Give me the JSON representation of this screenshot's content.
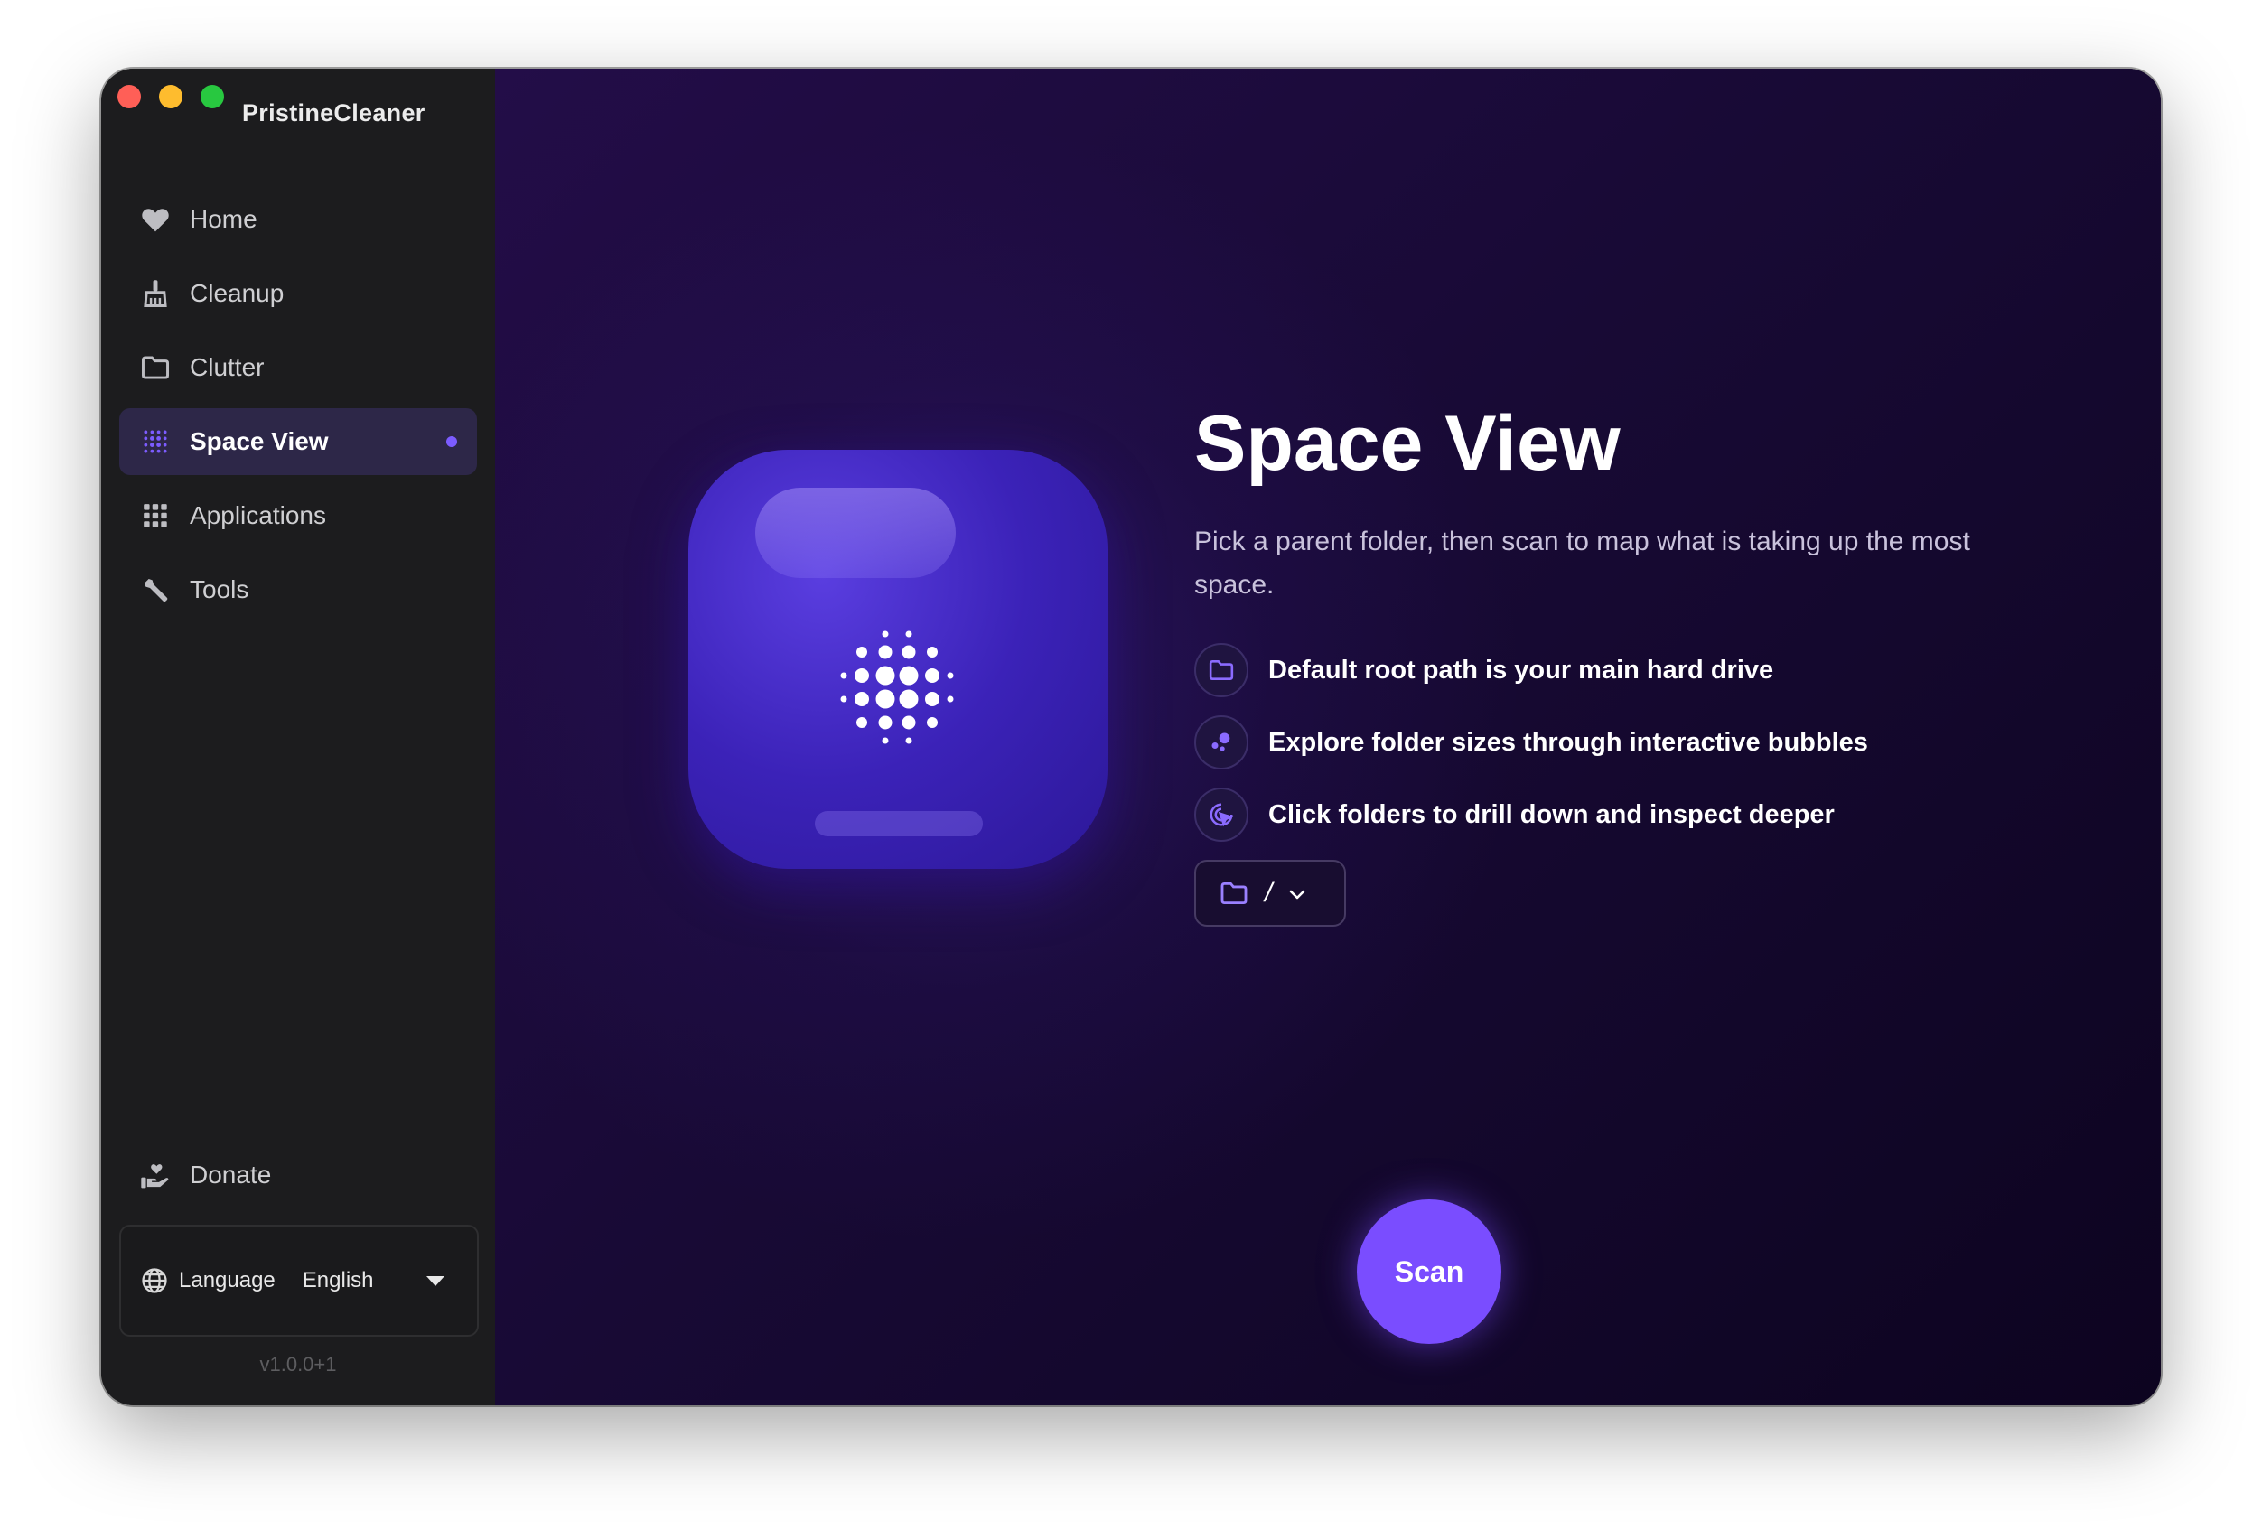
{
  "app": {
    "title": "PristineCleaner",
    "version": "v1.0.0+1"
  },
  "sidebar": {
    "items": [
      {
        "label": "Home",
        "icon": "heart-icon"
      },
      {
        "label": "Cleanup",
        "icon": "broom-icon"
      },
      {
        "label": "Clutter",
        "icon": "folder-icon"
      },
      {
        "label": "Space View",
        "icon": "dot-grid-icon",
        "active": true
      },
      {
        "label": "Applications",
        "icon": "apps-grid-icon"
      },
      {
        "label": "Tools",
        "icon": "wrench-icon"
      }
    ],
    "donate_label": "Donate",
    "language_label": "Language",
    "language_value": "English"
  },
  "main": {
    "title": "Space View",
    "subtitle": "Pick a parent folder, then scan to map what is taking up the most space.",
    "features": [
      {
        "text": "Default root path is your main hard drive",
        "icon": "folder-icon"
      },
      {
        "text": "Explore folder sizes through interactive bubbles",
        "icon": "bubbles-icon"
      },
      {
        "text": "Click folders to drill down and inspect deeper",
        "icon": "cursor-click-icon"
      }
    ],
    "path_value": "/",
    "scan_label": "Scan"
  },
  "colors": {
    "accent": "#7a4dff",
    "sidebar_bg": "#1c1c1e",
    "active_item_bg": "#2d2748"
  }
}
